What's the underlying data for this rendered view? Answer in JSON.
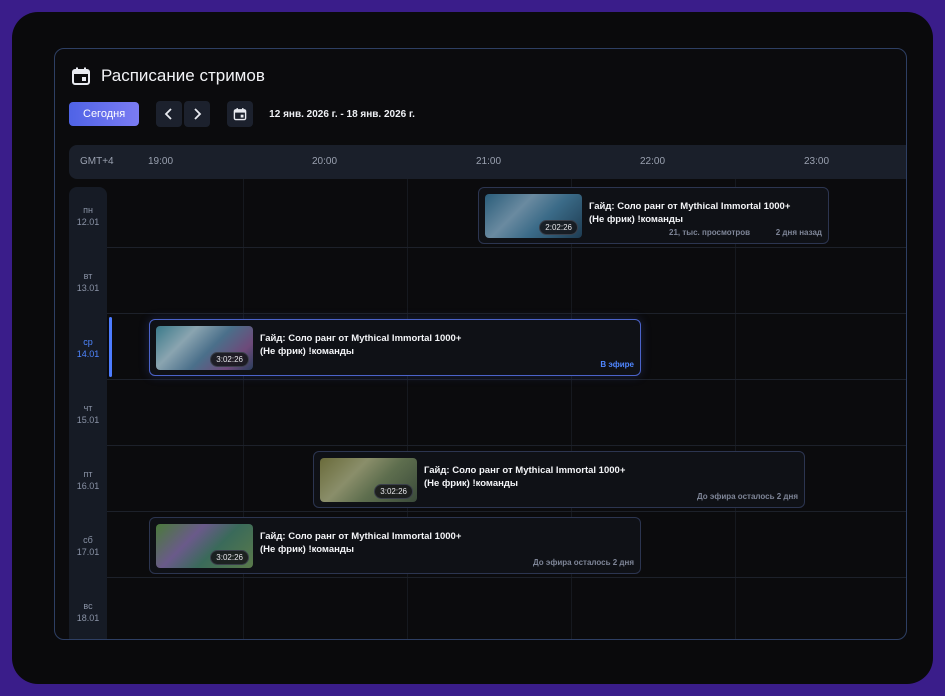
{
  "page": {
    "title": "Расписание стримов",
    "today_label": "Сегодня",
    "date_range": "12 янв. 2026 г. - 18 янв. 2026 г."
  },
  "timeline": {
    "timezone": "GMT+4",
    "hours": [
      "19:00",
      "20:00",
      "21:00",
      "22:00",
      "23:00"
    ]
  },
  "days": [
    {
      "weekday": "пн",
      "date": "12.01"
    },
    {
      "weekday": "вт",
      "date": "13.01"
    },
    {
      "weekday": "ср",
      "date": "14.01"
    },
    {
      "weekday": "чт",
      "date": "15.01"
    },
    {
      "weekday": "пт",
      "date": "16.01"
    },
    {
      "weekday": "сб",
      "date": "17.01"
    },
    {
      "weekday": "вс",
      "date": "18.01"
    }
  ],
  "events": [
    {
      "title_line1": "Гайд: Соло ранг от Mythical Immortal 1000+",
      "title_line2": "(Не фрик) !команды",
      "duration": "2:02:26",
      "views": "21, тыс. просмотров",
      "ago": "2 дня назад"
    },
    {
      "title_line1": "Гайд: Соло ранг от Mythical Immortal 1000+",
      "title_line2": "(Не фрик) !команды",
      "duration": "3:02:26",
      "status": "В эфире"
    },
    {
      "title_line1": "Гайд: Соло ранг от Mythical Immortal 1000+",
      "title_line2": "(Не фрик) !команды",
      "duration": "3:02:26",
      "status": "До эфира осталось 2 дня"
    },
    {
      "title_line1": "Гайд: Соло ранг от Mythical Immortal 1000+",
      "title_line2": "(Не фрик) !команды",
      "duration": "3:02:26",
      "status": "До эфира осталось 2 дня"
    }
  ],
  "colors": {
    "accent": "#4f86ff",
    "today_start": "#4f63e6",
    "today_end": "#7b7cf3",
    "frame": "#3a1d8a"
  },
  "icons": {
    "title": "calendar-icon",
    "prev": "chevron-left-icon",
    "next": "chevron-right-icon",
    "picker": "calendar-icon"
  }
}
